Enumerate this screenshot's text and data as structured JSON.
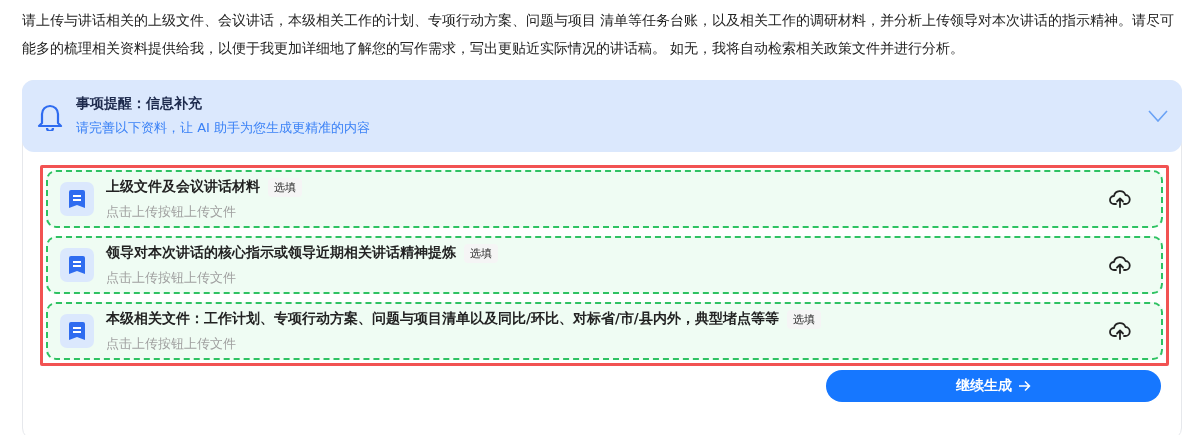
{
  "intro": "请上传与讲话相关的上级文件、会议讲话，本级相关工作的计划、专项行动方案、问题与项目 清单等任务台账，以及相关工作的调研材料，并分析上传领导对本次讲话的指示精神。请尽可能多的梳理相关资料提供给我，以便于我更加详细地了解您的写作需求，写出更贴近实际情况的讲话稿。 如无，我将自动检索相关政策文件并进行分析。",
  "notice": {
    "title": "事项提醒：信息补充",
    "subtitle": "请完善以下资料，让 AI 助手为您生成更精准的内容",
    "expanded": true
  },
  "uploads": [
    {
      "title": "上级文件及会议讲话材料",
      "tag": "选填",
      "hint": "点击上传按钮上传文件"
    },
    {
      "title": "领导对本次讲话的核心指示或领导近期相关讲话精神提炼",
      "tag": "选填",
      "hint": "点击上传按钮上传文件"
    },
    {
      "title": "本级相关文件：工作计划、专项行动方案、问题与项目清单以及同比/环比、对标省/市/县内外，典型堵点等等",
      "tag": "选填",
      "hint": "点击上传按钮上传文件"
    }
  ],
  "continue_button": "继续生成"
}
